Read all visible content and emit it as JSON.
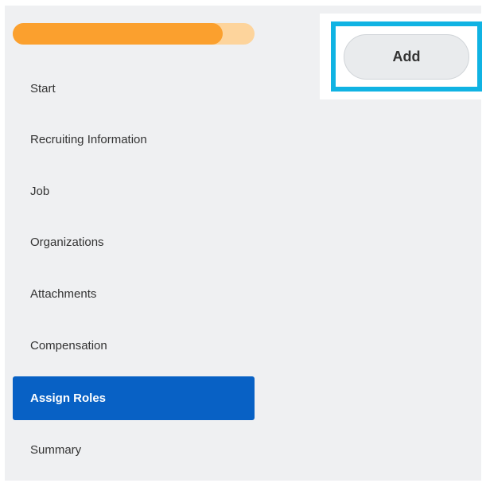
{
  "progress": {
    "fraction": 0.87,
    "fill_color": "#fba02e",
    "track_color": "#fdd49c"
  },
  "steps": [
    {
      "label": "Start",
      "active": false
    },
    {
      "label": "Recruiting Information",
      "active": false
    },
    {
      "label": "Job",
      "active": false
    },
    {
      "label": "Organizations",
      "active": false
    },
    {
      "label": "Attachments",
      "active": false
    },
    {
      "label": "Compensation",
      "active": false
    },
    {
      "label": "Assign Roles",
      "active": true
    },
    {
      "label": "Summary",
      "active": false
    }
  ],
  "actions": {
    "add_label": "Add"
  },
  "colors": {
    "active_step": "#0861c5",
    "highlight_outline": "#10b3e3",
    "panel_background": "#eff0f2"
  }
}
